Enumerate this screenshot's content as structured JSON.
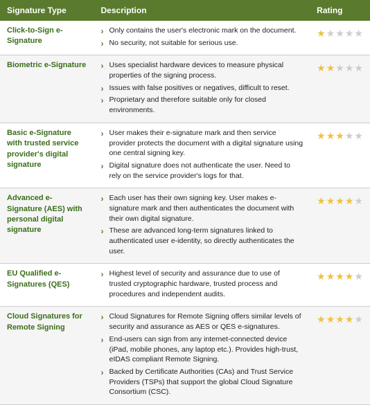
{
  "table": {
    "headers": {
      "col1": "Signature Type",
      "col2": "Description",
      "col3": "Rating"
    },
    "rows": [
      {
        "type": "Click-to-Sign e-Signature",
        "bullets": [
          "Only contains the user's electronic mark on the document.",
          "No security, not suitable for serious use."
        ],
        "stars": [
          1,
          0,
          0,
          0,
          0
        ]
      },
      {
        "type": "Biometric e-Signature",
        "bullets": [
          "Uses specialist hardware devices to measure physical properties of the signing process.",
          "Issues with false positives or negatives, difficult to reset.",
          "Proprietary and therefore suitable only for closed environments."
        ],
        "stars": [
          1,
          1,
          0,
          0,
          0
        ]
      },
      {
        "type": "Basic e-Signature with trusted service provider's digital signature",
        "bullets": [
          "User makes their e-signature mark and then service provider protects the document with a digital signature using one central signing key.",
          "Digital signature does not authenticate the user. Need to rely on the service provider's logs for that."
        ],
        "stars": [
          1,
          1,
          1,
          0,
          0
        ]
      },
      {
        "type": "Advanced e-Signature (AES) with personal digital signature",
        "bullets": [
          "Each user has their own signing key. User makes e-signature mark and then authenticates the document with their own digital signature.",
          "These are advanced long-term signatures linked to authenticated user e-identity, so directly authenticates the user."
        ],
        "stars": [
          1,
          1,
          1,
          1,
          0
        ]
      },
      {
        "type": "EU Qualified e-Signatures (QES)",
        "bullets": [
          "Highest level of security and assurance due to use of trusted cryptographic hardware, trusted process and procedures and independent audits."
        ],
        "stars": [
          1,
          1,
          1,
          1,
          0
        ]
      },
      {
        "type": "Cloud Signatures for Remote Signing",
        "bullets": [
          "Cloud Signatures for Remote Signing offers similar levels of security and assurance as AES or QES e-signatures.",
          "End-users can sign from any internet-connected device (iPad, mobile phones, any laptop etc.). Provides high-trust, eIDAS compliant Remote Signing.",
          "Backed by Certificate Authorities (CAs) and Trust Service Providers (TSPs) that support the global Cloud Signature Consortium (CSC)."
        ],
        "stars": [
          1,
          1,
          1,
          1,
          0
        ]
      }
    ]
  }
}
